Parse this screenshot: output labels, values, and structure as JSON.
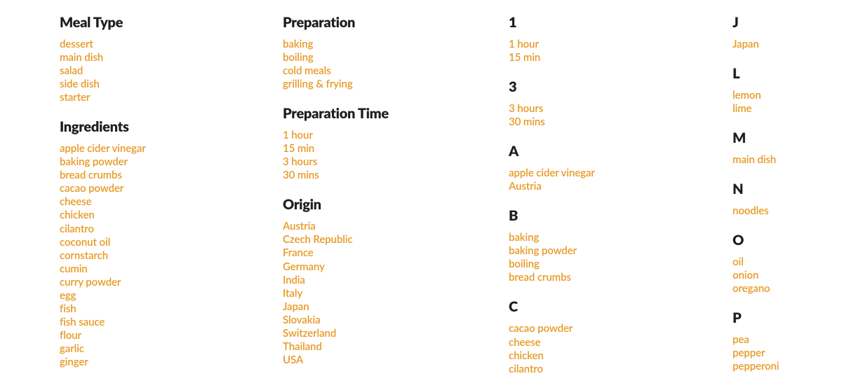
{
  "col1": [
    {
      "heading": "Meal Type",
      "items": [
        "dessert",
        "main dish",
        "salad",
        "side dish",
        "starter"
      ]
    },
    {
      "heading": "Ingredients",
      "items": [
        "apple cider vinegar",
        "baking powder",
        "bread crumbs",
        "cacao powder",
        "cheese",
        "chicken",
        "cilantro",
        "coconut oil",
        "cornstarch",
        "cumin",
        "curry powder",
        "egg",
        "fish",
        "fish sauce",
        "flour",
        "garlic",
        "ginger"
      ]
    }
  ],
  "col2": [
    {
      "heading": "Preparation",
      "items": [
        "baking",
        "boiling",
        "cold meals",
        "grilling & frying"
      ]
    },
    {
      "heading": "Preparation Time",
      "items": [
        "1 hour",
        "15 min",
        "3 hours",
        "30 mins"
      ]
    },
    {
      "heading": "Origin",
      "items": [
        "Austria",
        "Czech Republic",
        "France",
        "Germany",
        "India",
        "Italy",
        "Japan",
        "Slovakia",
        "Switzerland",
        "Thailand",
        "USA"
      ]
    }
  ],
  "col3": [
    {
      "heading": "1",
      "items": [
        "1 hour",
        "15 min"
      ]
    },
    {
      "heading": "3",
      "items": [
        "3 hours",
        "30 mins"
      ]
    },
    {
      "heading": "A",
      "items": [
        "apple cider vinegar",
        "Austria"
      ]
    },
    {
      "heading": "B",
      "items": [
        "baking",
        "baking powder",
        "boiling",
        "bread crumbs"
      ]
    },
    {
      "heading": "C",
      "items": [
        "cacao powder",
        "cheese",
        "chicken",
        "cilantro"
      ]
    }
  ],
  "col4": [
    {
      "heading": "J",
      "items": [
        "Japan"
      ]
    },
    {
      "heading": "L",
      "items": [
        "lemon",
        "lime"
      ]
    },
    {
      "heading": "M",
      "items": [
        "main dish"
      ]
    },
    {
      "heading": "N",
      "items": [
        "noodles"
      ]
    },
    {
      "heading": "O",
      "items": [
        "oil",
        "onion",
        "oregano"
      ]
    },
    {
      "heading": "P",
      "items": [
        "pea",
        "pepper",
        "pepperoni"
      ]
    }
  ]
}
